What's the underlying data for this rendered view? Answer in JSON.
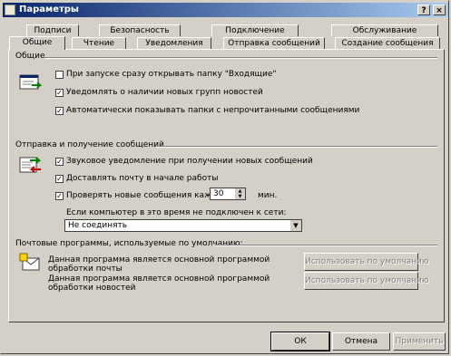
{
  "title": "Параметры",
  "title_buttons": {
    "help": "?",
    "close": "×"
  },
  "tabs_back": [
    "Подписи",
    "Безопасность",
    "Подключение",
    "Обслуживание"
  ],
  "tabs_front": [
    "Общие",
    "Чтение",
    "Уведомления",
    "Отправка сообщений",
    "Создание сообщения"
  ],
  "groups": {
    "general": "Общие",
    "sendrecv": "Отправка и получение сообщений",
    "mailprograms": "Почтовые программы, используемые по умолчанию:"
  },
  "general_options": [
    {
      "label": "При запуске сразу открывать папку \"Входящие\"",
      "checked": false
    },
    {
      "label": "Уведомлять о наличии новых групп новостей",
      "checked": true
    },
    {
      "label": "Автоматически показывать папки с непрочитанными сообщениями",
      "checked": true
    }
  ],
  "sendrecv_options": [
    {
      "label": "Звуковое уведомление при получении новых сообщений",
      "checked": true
    },
    {
      "label": "Доставлять почту в начале работы",
      "checked": true
    },
    {
      "label": "Проверять новые сообщения каждые",
      "checked": true
    }
  ],
  "check_interval": {
    "value": "30",
    "unit": "мин."
  },
  "offline": {
    "label": "Если компьютер в это время не подключен к сети:",
    "selected": "Не соединять"
  },
  "mail_defaults": [
    {
      "text": "Данная программа является основной программой обработки почты",
      "button": "Использовать по умолчанию"
    },
    {
      "text": "Данная программа является основной программой обработки новостей",
      "button": "Использовать по умолчанию"
    }
  ],
  "buttons": {
    "ok": "ОК",
    "cancel": "Отмена",
    "apply": "Применить"
  }
}
